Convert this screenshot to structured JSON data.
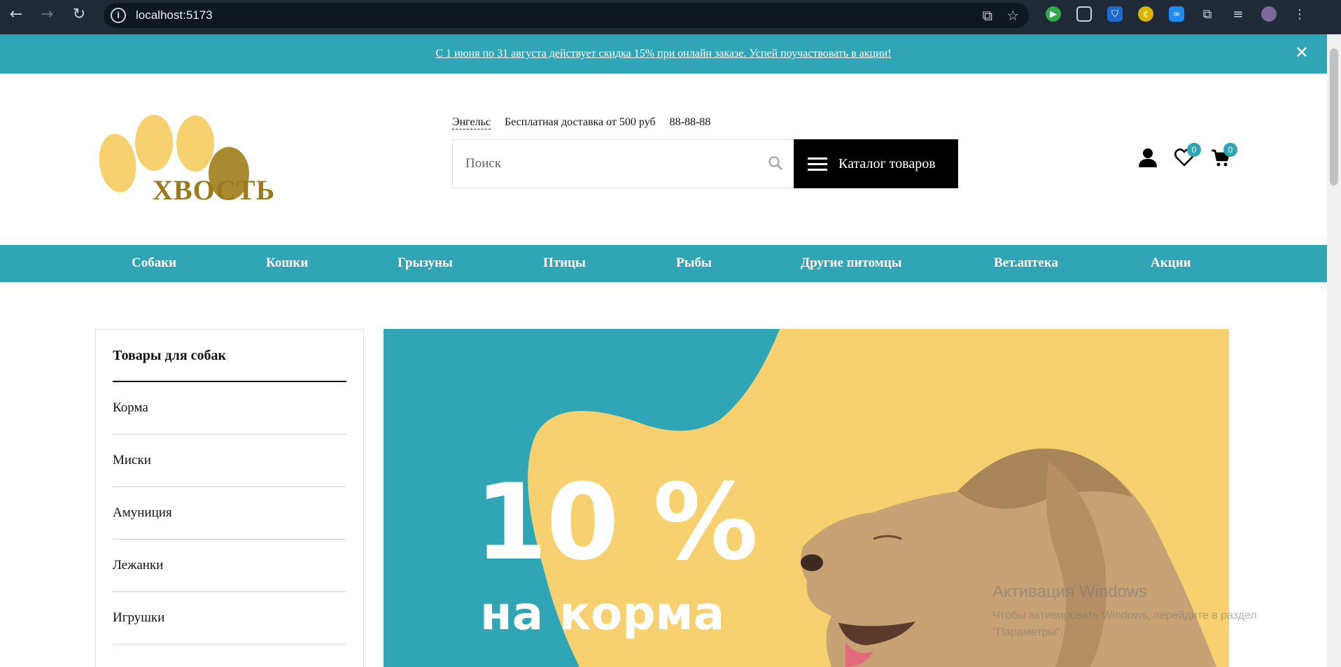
{
  "browser": {
    "url": "localhost:5173"
  },
  "promo": {
    "text": "С 1 июня по 31 августа действует скидка 15% при онлайн заказе. Успей поучаствовать в акции!"
  },
  "header": {
    "logo_text": "ХВОСТЬ",
    "city": "Энгельс",
    "delivery": "Бесплатная доставка от 500 руб",
    "phone": "88-88-88",
    "search_placeholder": "Поиск",
    "catalog_label": "Каталог товаров",
    "favorites_count": "0",
    "cart_count": "0"
  },
  "catnav": {
    "items": [
      "Собаки",
      "Кошки",
      "Грызуны",
      "Птицы",
      "Рыбы",
      "Другие питомцы",
      "Вет.аптека",
      "Акции"
    ]
  },
  "sidebar": {
    "title": "Товары для собак",
    "items": [
      "Корма",
      "Миски",
      "Амуниция",
      "Лежанки",
      "Игрушки"
    ]
  },
  "banner": {
    "percent": "10 %",
    "subtitle": "на корма"
  },
  "watermark": {
    "title": "Активация Windows",
    "subtitle": "Чтобы активировать Windows, перейдите в раздел \"Параметры\"."
  },
  "colors": {
    "accent": "#2fa5b5",
    "banner_yellow": "#f7d170",
    "logo_brown": "#9b7a1f"
  }
}
